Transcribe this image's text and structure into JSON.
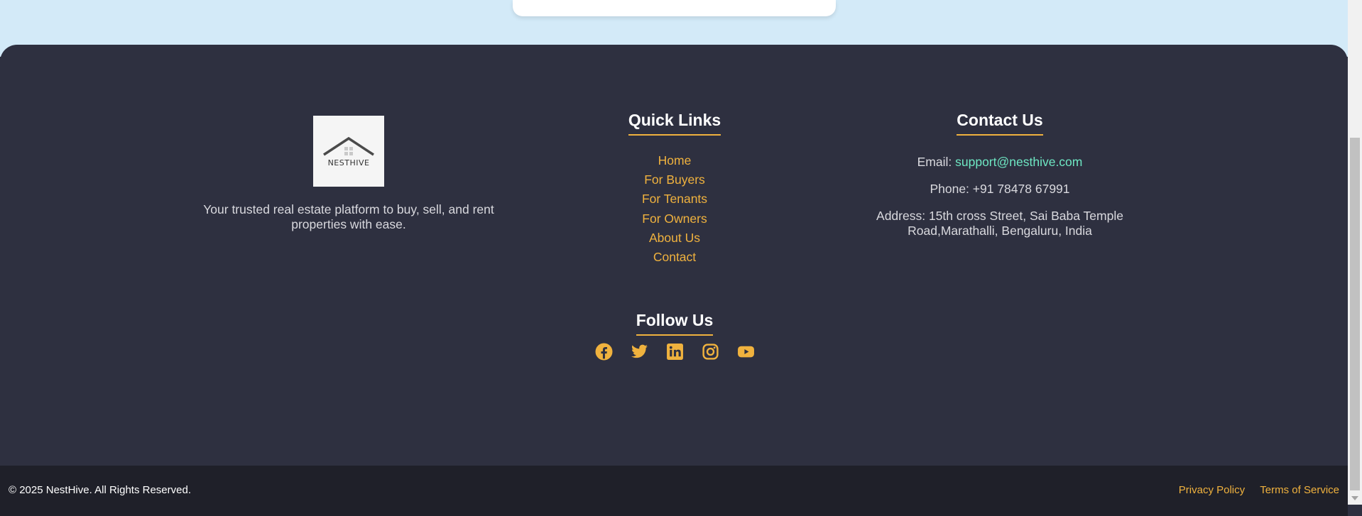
{
  "brand": {
    "logo_text": "NESTHIVE",
    "tagline": "Your trusted real estate platform to buy, sell, and rent properties with ease."
  },
  "quick_links": {
    "heading": "Quick Links",
    "items": [
      "Home",
      "For Buyers",
      "For Tenants",
      "For Owners",
      "About Us",
      "Contact"
    ]
  },
  "contact": {
    "heading": "Contact Us",
    "email_label": "Email:",
    "email_value": "support@nesthive.com",
    "phone": "Phone: +91 78478 67991",
    "address": "Address: 15th cross Street, Sai Baba Temple Road,Marathalli, Bengaluru, India"
  },
  "follow": {
    "heading": "Follow Us",
    "icons": [
      "facebook-icon",
      "twitter-icon",
      "linkedin-icon",
      "instagram-icon",
      "youtube-icon"
    ]
  },
  "bottom_bar": {
    "copyright": "© 2025 NestHive. All Rights Reserved.",
    "privacy": "Privacy Policy",
    "terms": "Terms of Service"
  },
  "colors": {
    "accent": "#f0b23e",
    "email": "#6ee7c3",
    "footer_bg": "#2e3040",
    "bottom_bar_bg": "#1f2029",
    "page_bg": "#d3eaf8"
  }
}
